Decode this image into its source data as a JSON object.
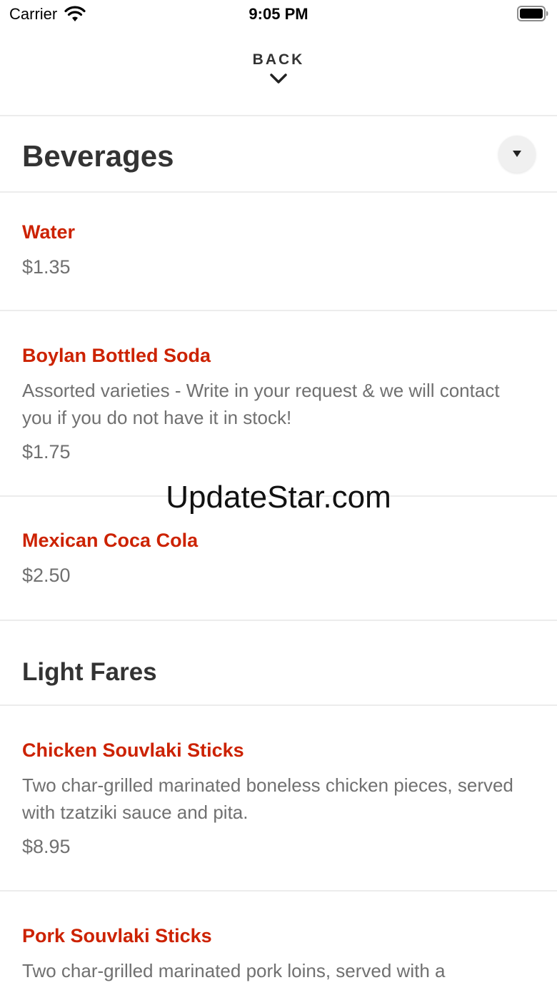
{
  "status_bar": {
    "carrier": "Carrier",
    "time": "9:05 PM"
  },
  "header": {
    "back_label": "BACK"
  },
  "sections": [
    {
      "title": "Beverages",
      "items": [
        {
          "name": "Water",
          "description": "",
          "price": "$1.35"
        },
        {
          "name": "Boylan Bottled Soda",
          "description": "Assorted varieties - Write in your request & we will contact you if you do not have it in stock!",
          "price": "$1.75"
        },
        {
          "name": "Mexican Coca Cola",
          "description": "",
          "price": "$2.50"
        }
      ]
    },
    {
      "title": "Light Fares",
      "items": [
        {
          "name": "Chicken Souvlaki Sticks",
          "description": "Two char-grilled marinated boneless chicken pieces, served with tzatziki sauce and pita.",
          "price": "$8.95"
        },
        {
          "name": "Pork Souvlaki Sticks",
          "description": "Two char-grilled marinated pork loins, served with a",
          "price": ""
        }
      ]
    }
  ],
  "watermark": "UpdateStar.com",
  "colors": {
    "item_name": "#cc2200",
    "secondary_text": "#707070",
    "divider": "#ececec"
  },
  "icons": [
    "wifi-icon",
    "battery-icon",
    "chevron-down-icon",
    "dropdown-triangle-icon"
  ]
}
